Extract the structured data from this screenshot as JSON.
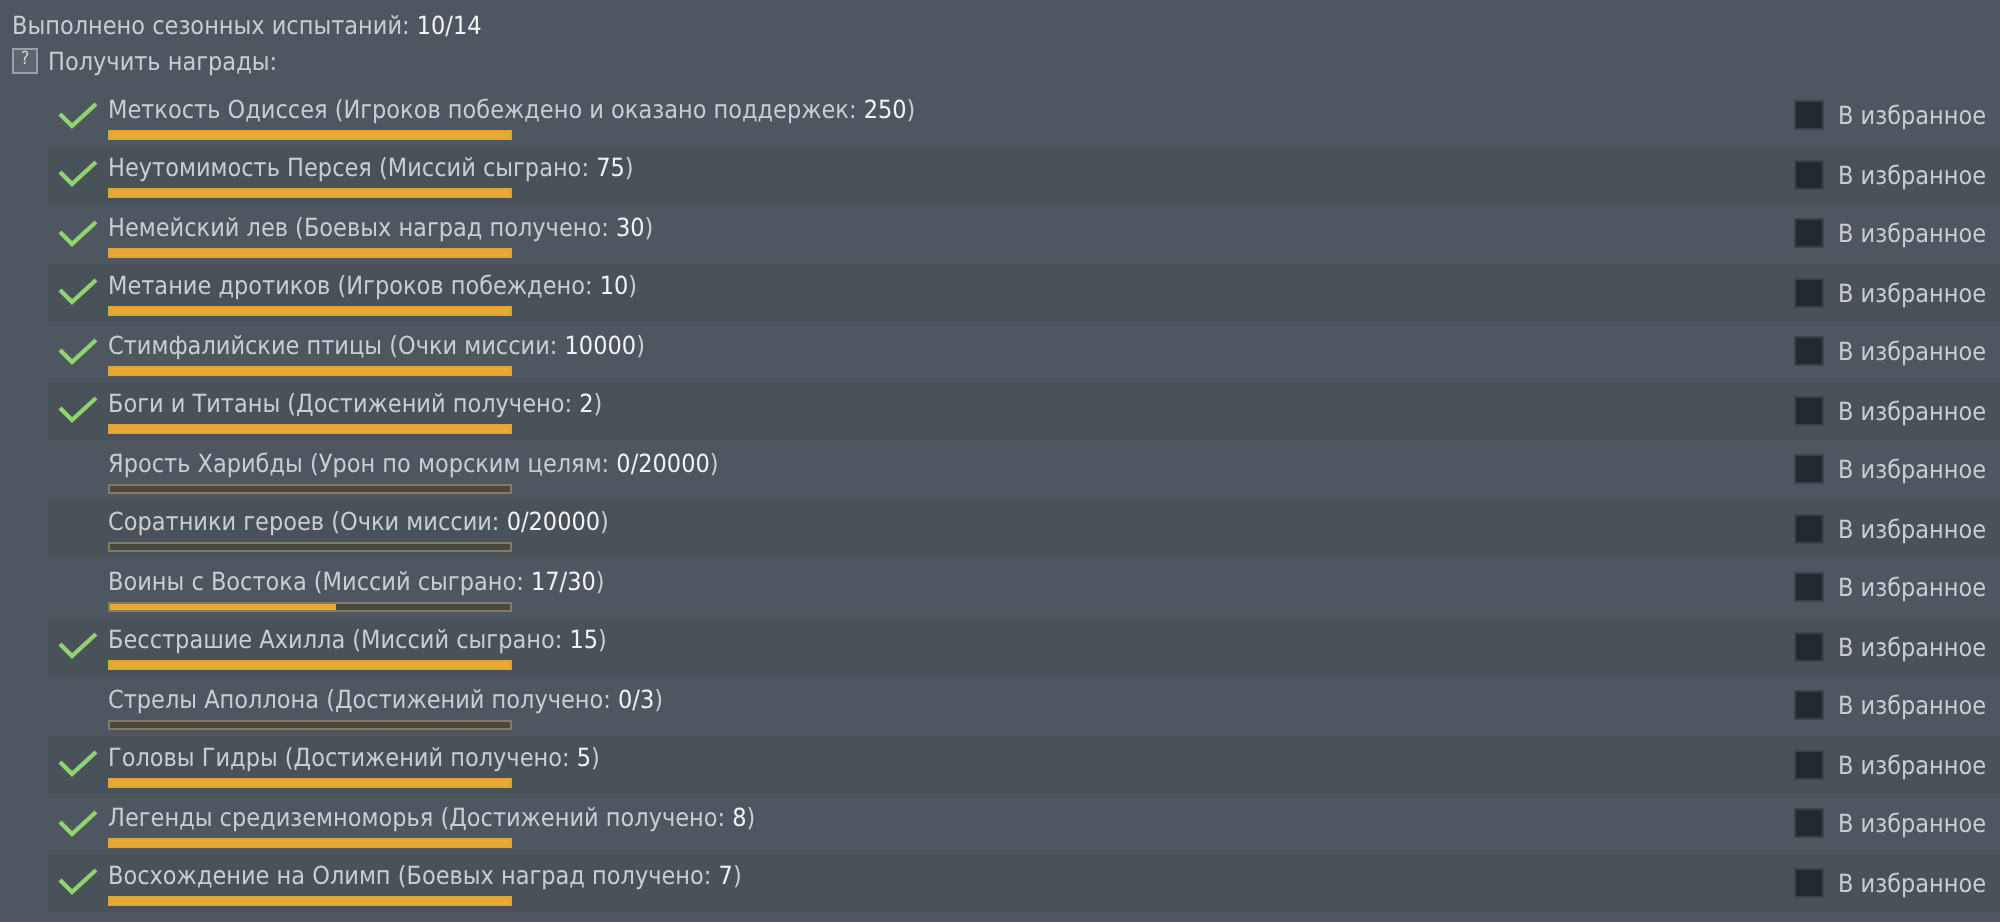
{
  "summary": "Выполнено сезонных испытаний: **10/14**",
  "rewards_toggle": {
    "icon_text": "?",
    "label": "Получить награды:"
  },
  "challenges": [
    {
      "title": "Меткость Одиссея (Игроков побеждено и оказано поддержек: **250**)",
      "completed": true,
      "level": 1,
      "favorite": {
        "label": "В избранное",
        "checked": false
      }
    },
    {
      "title": "Неутомимость Персея (Миссий сыграно: **75**)",
      "completed": true,
      "level": 1,
      "favorite": {
        "label": "В избранное",
        "checked": false
      }
    },
    {
      "title": "Немейский лев (Боевых наград получено: **30**)",
      "completed": true,
      "level": 1,
      "favorite": {
        "label": "В избранное",
        "checked": false
      }
    },
    {
      "title": "Метание дротиков (Игроков побеждено: **10**)",
      "completed": true,
      "level": 1,
      "favorite": {
        "label": "В избранное",
        "checked": false
      }
    },
    {
      "title": "Стимфалийские птицы (Очки миссии: **10000**)",
      "completed": true,
      "level": 1,
      "favorite": {
        "label": "В избранное",
        "checked": false
      }
    },
    {
      "title": "Боги и Титаны (Достижений получено: **2**)",
      "completed": true,
      "level": 1,
      "favorite": {
        "label": "В избранное",
        "checked": false
      }
    },
    {
      "title": "Ярость Харибды (Урон по морским целям: **0/20000**)",
      "completed": false,
      "level": 0,
      "favorite": {
        "label": "В избранное",
        "checked": false
      }
    },
    {
      "title": "Соратники героев (Очки миссии: **0/20000**)",
      "completed": false,
      "level": 0,
      "favorite": {
        "label": "В избранное",
        "checked": false
      }
    },
    {
      "title": "Воины с Востока (Миссий сыграно: **17/30**)",
      "completed": false,
      "level": 0.567,
      "favorite": {
        "label": "В избранное",
        "checked": false
      }
    },
    {
      "title": "Бесстрашие Ахилла (Миссий сыграно: **15**)",
      "completed": true,
      "level": 1,
      "favorite": {
        "label": "В избранное",
        "checked": false
      }
    },
    {
      "title": "Стрелы Аполлона (Достижений получено: **0/3**)",
      "completed": false,
      "level": 0,
      "favorite": {
        "label": "В избранное",
        "checked": false
      }
    },
    {
      "title": "Головы Гидры (Достижений получено: **5**)",
      "completed": true,
      "level": 1,
      "favorite": {
        "label": "В избранное",
        "checked": false
      }
    },
    {
      "title": "Легенды средиземноморья (Достижений получено: **8**)",
      "completed": true,
      "level": 1,
      "favorite": {
        "label": "В избранное",
        "checked": false
      }
    },
    {
      "title": "Восхождение на Олимп (Боевых наград получено: **7**)",
      "completed": true,
      "level": 1,
      "favorite": {
        "label": "В избранное",
        "checked": false
      }
    }
  ]
}
